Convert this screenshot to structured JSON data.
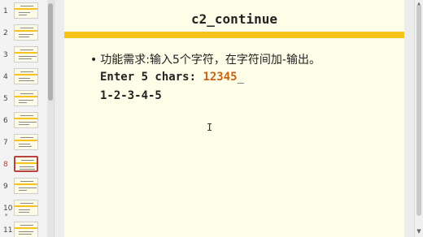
{
  "thumbnails": [
    {
      "number": "1",
      "active": false,
      "star": false
    },
    {
      "number": "2",
      "active": false,
      "star": false
    },
    {
      "number": "3",
      "active": false,
      "star": false
    },
    {
      "number": "4",
      "active": false,
      "star": false
    },
    {
      "number": "5",
      "active": false,
      "star": false
    },
    {
      "number": "6",
      "active": false,
      "star": false
    },
    {
      "number": "7",
      "active": false,
      "star": false
    },
    {
      "number": "8",
      "active": true,
      "star": false
    },
    {
      "number": "9",
      "active": false,
      "star": false
    },
    {
      "number": "10",
      "active": false,
      "star": true
    },
    {
      "number": "11",
      "active": false,
      "star": false
    }
  ],
  "star_glyph": "*",
  "slide": {
    "title": "c2_continue",
    "bullet_text": "功能需求:输入5个字符，在字符间加-输出。",
    "code_prompt": "Enter 5 chars: ",
    "code_input": "12345",
    "code_cursor": "_",
    "code_output": "1-2-3-4-5"
  },
  "colors": {
    "slide_background": "#fdfde8",
    "accent_bar": "#f6c21c",
    "input_text": "#c86414",
    "active_thumbnail_border": "#b8423f"
  },
  "icons": {
    "mouse_cursor": "text-cursor-icon",
    "scroll_up": "chevron-up-icon",
    "scroll_down": "chevron-down-icon"
  }
}
